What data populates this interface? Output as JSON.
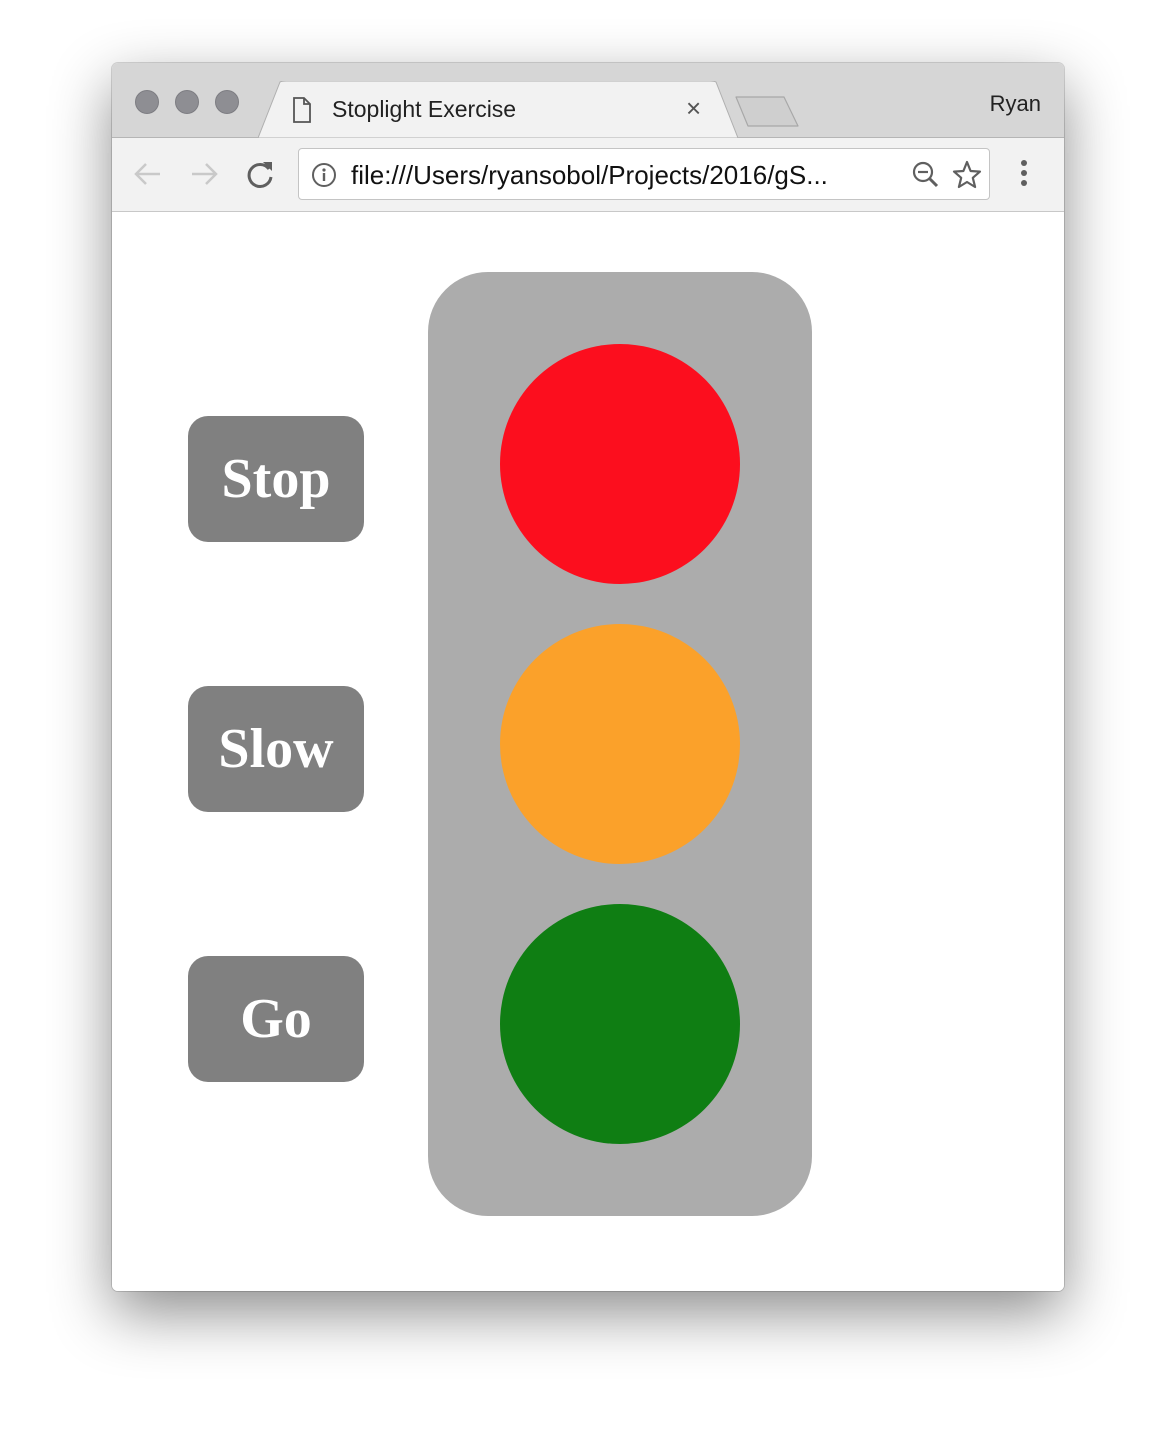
{
  "browser": {
    "tab_title": "Stoplight Exercise",
    "profile_name": "Ryan",
    "url": "file:///Users/ryansobol/Projects/2016/gS...",
    "icons": {
      "tab": "document-icon",
      "close": "close-icon",
      "back": "arrow-left-icon",
      "forward": "arrow-right-icon",
      "reload": "reload-icon",
      "info": "info-icon",
      "zoom": "zoom-out-icon",
      "bookmark": "star-icon",
      "menu": "kebab-menu-icon"
    },
    "tab_close_glyph": "×"
  },
  "page": {
    "buttons": [
      {
        "label": "Stop"
      },
      {
        "label": "Slow"
      },
      {
        "label": "Go"
      }
    ],
    "stoplight": {
      "housing_color": "#acacac",
      "bulbs": [
        {
          "name": "stop",
          "color": "#fc0e1e"
        },
        {
          "name": "slow",
          "color": "#fba12a"
        },
        {
          "name": "go",
          "color": "#0f7e13"
        }
      ]
    }
  }
}
